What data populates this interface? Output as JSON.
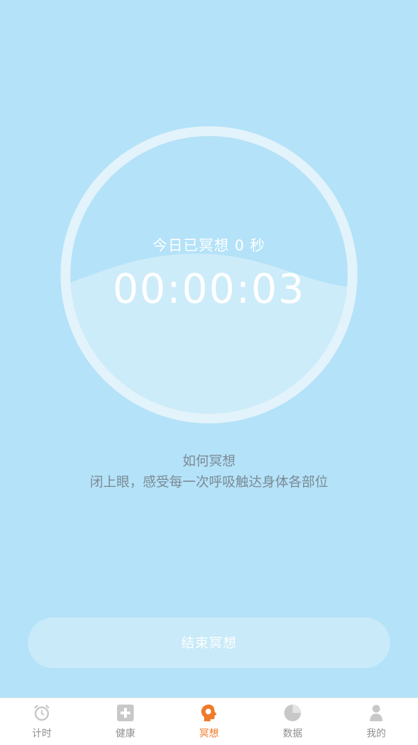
{
  "meditation": {
    "today_label": "今日已冥想 0 秒",
    "timer": "00:00:03",
    "fill_fraction": 0.48
  },
  "howto": {
    "title": "如何冥想",
    "description": "闭上眼，感受每一次呼吸触达身体各部位"
  },
  "end_button_label": "结束冥想",
  "tabs": [
    {
      "label": "计时",
      "icon": "alarm-clock-icon",
      "active": false
    },
    {
      "label": "健康",
      "icon": "health-cross-icon",
      "active": false
    },
    {
      "label": "冥想",
      "icon": "meditation-head-icon",
      "active": true
    },
    {
      "label": "数据",
      "icon": "pie-chart-icon",
      "active": false
    },
    {
      "label": "我的",
      "icon": "person-icon",
      "active": false
    }
  ],
  "colors": {
    "background": "#b4e2f8",
    "ring": "#e3f3fb",
    "water": "#cdecfa",
    "tab_active": "#ef7a2a",
    "tab_inactive": "#c8c8c8"
  }
}
